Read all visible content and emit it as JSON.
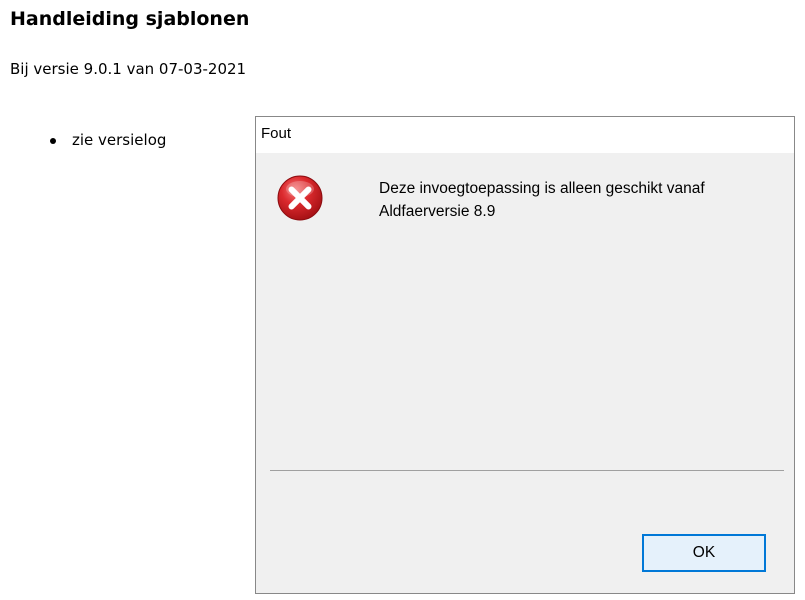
{
  "page": {
    "title": "Handleiding sjablonen",
    "subtitle": "Bij versie 9.0.1 van 07-03-2021",
    "list_items": [
      "zie versielog"
    ]
  },
  "dialog": {
    "title": "Fout",
    "icon": "error-icon",
    "message": "Deze invoegtoepassing is alleen geschikt vanaf Aldfaerversie 8.9",
    "ok_label": "OK",
    "accent_color": "#0078d7",
    "error_color": "#d8262b"
  }
}
